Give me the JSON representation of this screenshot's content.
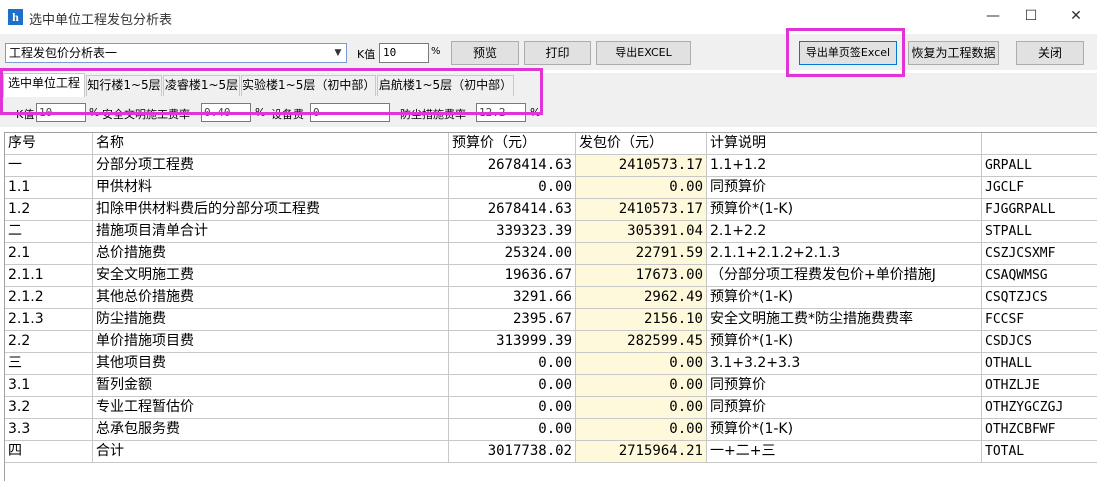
{
  "window": {
    "title": "选中单位工程发包分析表",
    "icon_glyph": "h",
    "controls": {
      "minimize": "—",
      "maximize": "☐",
      "close": "✕"
    }
  },
  "toolbar": {
    "report_select": "工程发包价分析表一",
    "k_label": "K值",
    "k_value": "10",
    "k_unit": "%",
    "preview": "预览",
    "print": "打印",
    "export_excel": "导出EXCEL",
    "export_sheet_excel": "导出单页签Excel",
    "restore": "恢复为工程数据",
    "close": "关闭"
  },
  "tabs": [
    {
      "label": "选中单位工程",
      "active": true
    },
    {
      "label": "知行楼1~5层",
      "active": false
    },
    {
      "label": "凌睿楼1~5层",
      "active": false
    },
    {
      "label": "实验楼1~5层（初中部）",
      "active": false
    },
    {
      "label": "启航楼1~5层（初中部）",
      "active": false
    }
  ],
  "params": {
    "k_label": "K值",
    "k_value": "10",
    "k_unit": "%",
    "safety_label": "安全文明施工费率",
    "safety_value": "0.40",
    "safety_unit": "%",
    "equipment_label": "设备费",
    "equipment_value": "0",
    "dust_label": "防尘措施费率",
    "dust_value": "12.2",
    "dust_unit": "%"
  },
  "table": {
    "headers": [
      "序号",
      "名称",
      "预算价（元）",
      "发包价（元）",
      "计算说明",
      ""
    ],
    "rows": [
      [
        "一",
        "分部分项工程费",
        "2678414.63",
        "2410573.17",
        "1.1+1.2",
        "GRPALL"
      ],
      [
        "1.1",
        "甲供材料",
        "0.00",
        "0.00",
        "同预算价",
        "JGCLF"
      ],
      [
        "1.2",
        "扣除甲供材料费后的分部分项工程费",
        "2678414.63",
        "2410573.17",
        "预算价*(1-K)",
        "FJGGRPALL"
      ],
      [
        "二",
        "措施项目清单合计",
        "339323.39",
        "305391.04",
        "2.1+2.2",
        "STPALL"
      ],
      [
        "2.1",
        "总价措施费",
        "25324.00",
        "22791.59",
        "2.1.1+2.1.2+2.1.3",
        "CSZJCSXMF"
      ],
      [
        "2.1.1",
        "安全文明施工费",
        "19636.67",
        "17673.00",
        "（分部分项工程费发包价+单价措施J",
        "CSAQWMSG"
      ],
      [
        "2.1.2",
        "其他总价措施费",
        "3291.66",
        "2962.49",
        "预算价*(1-K)",
        "CSQTZJCS"
      ],
      [
        "2.1.3",
        "防尘措施费",
        "2395.67",
        "2156.10",
        "安全文明施工费*防尘措施费费率",
        "FCCSF"
      ],
      [
        "2.2",
        "单价措施项目费",
        "313999.39",
        "282599.45",
        "预算价*(1-K)",
        "CSDJCS"
      ],
      [
        "三",
        "其他项目费",
        "0.00",
        "0.00",
        "3.1+3.2+3.3",
        "OTHALL"
      ],
      [
        "3.1",
        "暂列金额",
        "0.00",
        "0.00",
        "同预算价",
        "OTHZLJE"
      ],
      [
        "3.2",
        "专业工程暂估价",
        "0.00",
        "0.00",
        "同预算价",
        "OTHZYGCZGJ"
      ],
      [
        "3.3",
        "总承包服务费",
        "0.00",
        "0.00",
        "预算价*(1-K)",
        "OTHZCBFWF"
      ],
      [
        "四",
        "合计",
        "3017738.02",
        "2715964.21",
        "一+二+三",
        "TOTAL"
      ]
    ]
  }
}
